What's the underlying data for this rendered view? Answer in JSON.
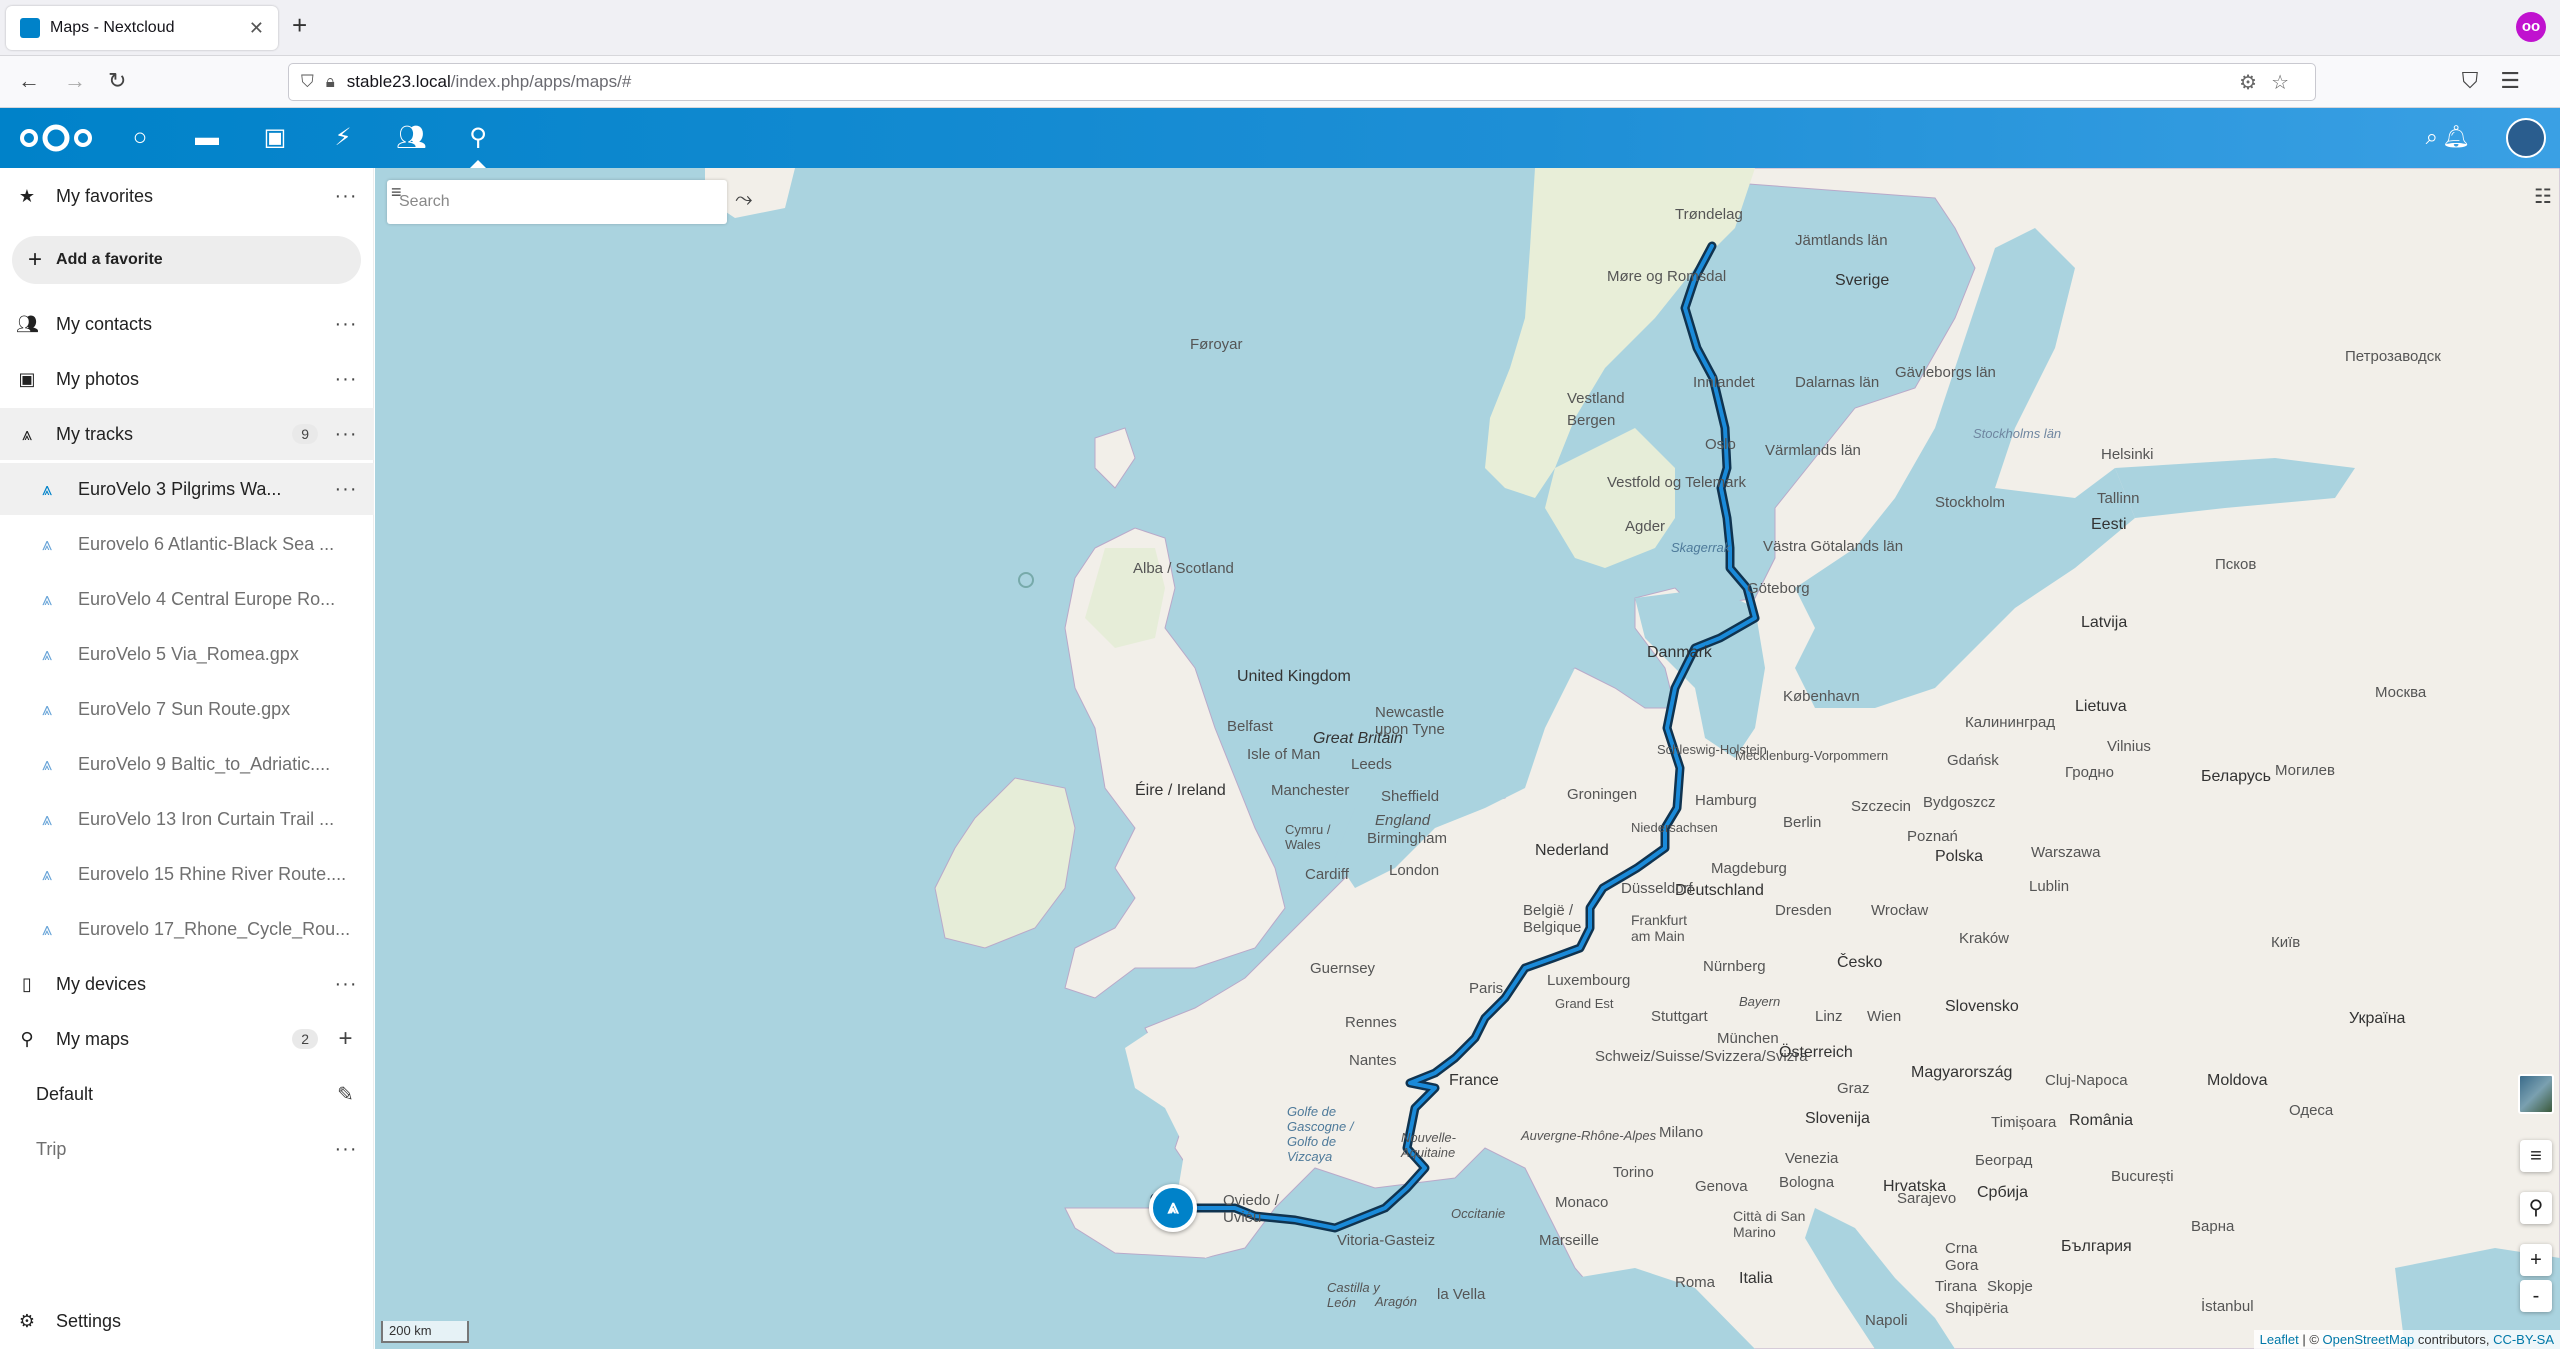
{
  "browser": {
    "tab_title": "Maps - Nextcloud",
    "url_host": "stable23.local",
    "url_path": "/index.php/apps/maps/#"
  },
  "header": {
    "apps": [
      "dashboard",
      "files",
      "photos",
      "activity",
      "contacts",
      "maps"
    ],
    "active_app": "maps"
  },
  "sidebar": {
    "favorites_label": "My favorites",
    "add_favorite_label": "Add a favorite",
    "contacts_label": "My contacts",
    "photos_label": "My photos",
    "tracks_label": "My tracks",
    "tracks_count": "9",
    "tracks": [
      "EuroVelo 3 Pilgrims Wa...",
      "Eurovelo 6 Atlantic-Black Sea ...",
      "EuroVelo 4 Central Europe Ro...",
      "EuroVelo 5 Via_Romea.gpx",
      "EuroVelo 7 Sun Route.gpx",
      "EuroVelo 9 Baltic_to_Adriatic....",
      "EuroVelo 13 Iron Curtain Trail ...",
      "Eurovelo 15 Rhine River Route....",
      "Eurovelo 17_Rhone_Cycle_Rou..."
    ],
    "devices_label": "My devices",
    "maps_label": "My maps",
    "maps_count": "2",
    "maps": [
      "Default",
      "Trip"
    ],
    "settings_label": "Settings"
  },
  "map": {
    "search_placeholder": "Search",
    "scale_label": "200 km",
    "attribution_leaflet": "Leaflet",
    "attribution_sep": " | © ",
    "attribution_osm": "OpenStreetMap",
    "attribution_contrib": " contributors, ",
    "attribution_license": "CC-BY-SA",
    "labels": {
      "trondelag": "Trøndelag",
      "more": "Møre og Romsdal",
      "jamtlands": "Jämtlands län",
      "sverige": "Sverige",
      "faroe": "Føroyar",
      "bergen": "Bergen",
      "vestland": "Vestland",
      "innlandet": "Innlandet",
      "dalarnas": "Dalarnas län",
      "gavleborgs": "Gävleborgs län",
      "oslo": "Oslo",
      "varmland": "Värmlands län",
      "vestfold": "Vestfold og Telemark",
      "agder": "Agder",
      "stockholm": "Stockholm",
      "alba": "Alba / Scotland",
      "skagerrak": "Skagerrak",
      "vgotaland": "Västra Götalands län",
      "goteborg": "Göteborg",
      "uk": "United Kingdom",
      "danmark": "Danmark",
      "kobenhavn": "København",
      "newcastle": "Newcastle upon Tyne",
      "belfast": "Belfast",
      "isleofman": "Isle of Man",
      "greatbritain": "Great Britain",
      "leeds": "Leeds",
      "eire": "Éire / Ireland",
      "manchester": "Manchester",
      "sheffield": "Sheffield",
      "england": "England",
      "birmingham": "Birmingham",
      "cymru": "Cymru / Wales",
      "cardiff": "Cardiff",
      "london": "London",
      "schleswig": "Schleswig-Holstein",
      "mecklenburg": "Mecklenburg-Vorpommern",
      "hamburg": "Hamburg",
      "groningen": "Groningen",
      "niedersachsen": "Niedersachsen",
      "nederland": "Nederland",
      "berlin": "Berlin",
      "szczecin": "Szczecin",
      "bydgoszcz": "Bydgoszcz",
      "gdansk": "Gdańsk",
      "poznan": "Poznań",
      "polska": "Polska",
      "warszawa": "Warszawa",
      "magdeburg": "Magdeburg",
      "deutschland": "Deutschland",
      "dusseldorf": "Düsseldorf",
      "belgie": "België / Belgique",
      "frankfurt": "Frankfurt am Main",
      "dresden": "Dresden",
      "wroclaw": "Wrocław",
      "krakow": "Kraków",
      "luxembourg": "Luxembourg",
      "grandest": "Grand Est",
      "nurnberg": "Nürnberg",
      "cesko": "Česko",
      "guernsey": "Guernsey",
      "paris": "Paris",
      "rennes": "Rennes",
      "stuttgart": "Stuttgart",
      "munchen": "München",
      "bayern": "Bayern",
      "linz": "Linz",
      "wien": "Wien",
      "slovensko": "Slovensko",
      "nantes": "Nantes",
      "france": "France",
      "schweiz": "Schweiz/Suisse/Svizzera/Svizra",
      "osterreich": "Österreich",
      "magyarorszag": "Magyarország",
      "graz": "Graz",
      "slovenija": "Slovenija",
      "golfe": "Golfe de Gascogne / Golfo de Vizcaya",
      "auvergne": "Auvergne-Rhône-Alpes",
      "milano": "Milano",
      "nouvelle": "Nouvelle-Aquitaine",
      "torino": "Torino",
      "venezia": "Venezia",
      "hrvatska": "Hrvatska",
      "oviedo": "Oviedo / Uviéu",
      "occitanie": "Occitanie",
      "monaco": "Monaco",
      "genova": "Genova",
      "bologna": "Bologna",
      "vitoria": "Vitoria-Gasteiz",
      "marseille": "Marseille",
      "sanmarino": "Città di San Marino",
      "castilla": "Castilla y León",
      "aragon": "Aragón",
      "lavilla": "la Vella",
      "roma": "Roma",
      "italia": "Italia",
      "helsinki": "Helsinki",
      "tallinn": "Tallinn",
      "eesti": "Eesti",
      "latvija": "Latvija",
      "lietuva": "Lietuva",
      "vilnius": "Vilnius",
      "kaliningrad": "Калининград",
      "belarus": "Беларусь",
      "moskva": "Москва",
      "pskov": "Псков",
      "petrozavodsk": "Петрозаводск",
      "grodno": "Гродно",
      "mogilev": "Могилев",
      "lublin": "Lublin",
      "kyiv": "Київ",
      "ukraina": "Україна",
      "moldova": "Moldova",
      "romania": "România",
      "bucuresti": "București",
      "sarajevo": "Sarajevo",
      "srbija": "Србија",
      "beograd": "Београд",
      "timisoara": "Timișoara",
      "clujnapoca": "Cluj-Napoca",
      "crnagora": "Crna Gora",
      "bulgaria": "България",
      "skopje": "Skopje",
      "tirana": "Tirana",
      "shqiperia": "Shqipëria",
      "istanbul": "İstanbul",
      "odesa": "Одеса",
      "varna": "Варна",
      "napoli": "Napoli",
      "stockholm_lan": "Stockholms län"
    }
  }
}
